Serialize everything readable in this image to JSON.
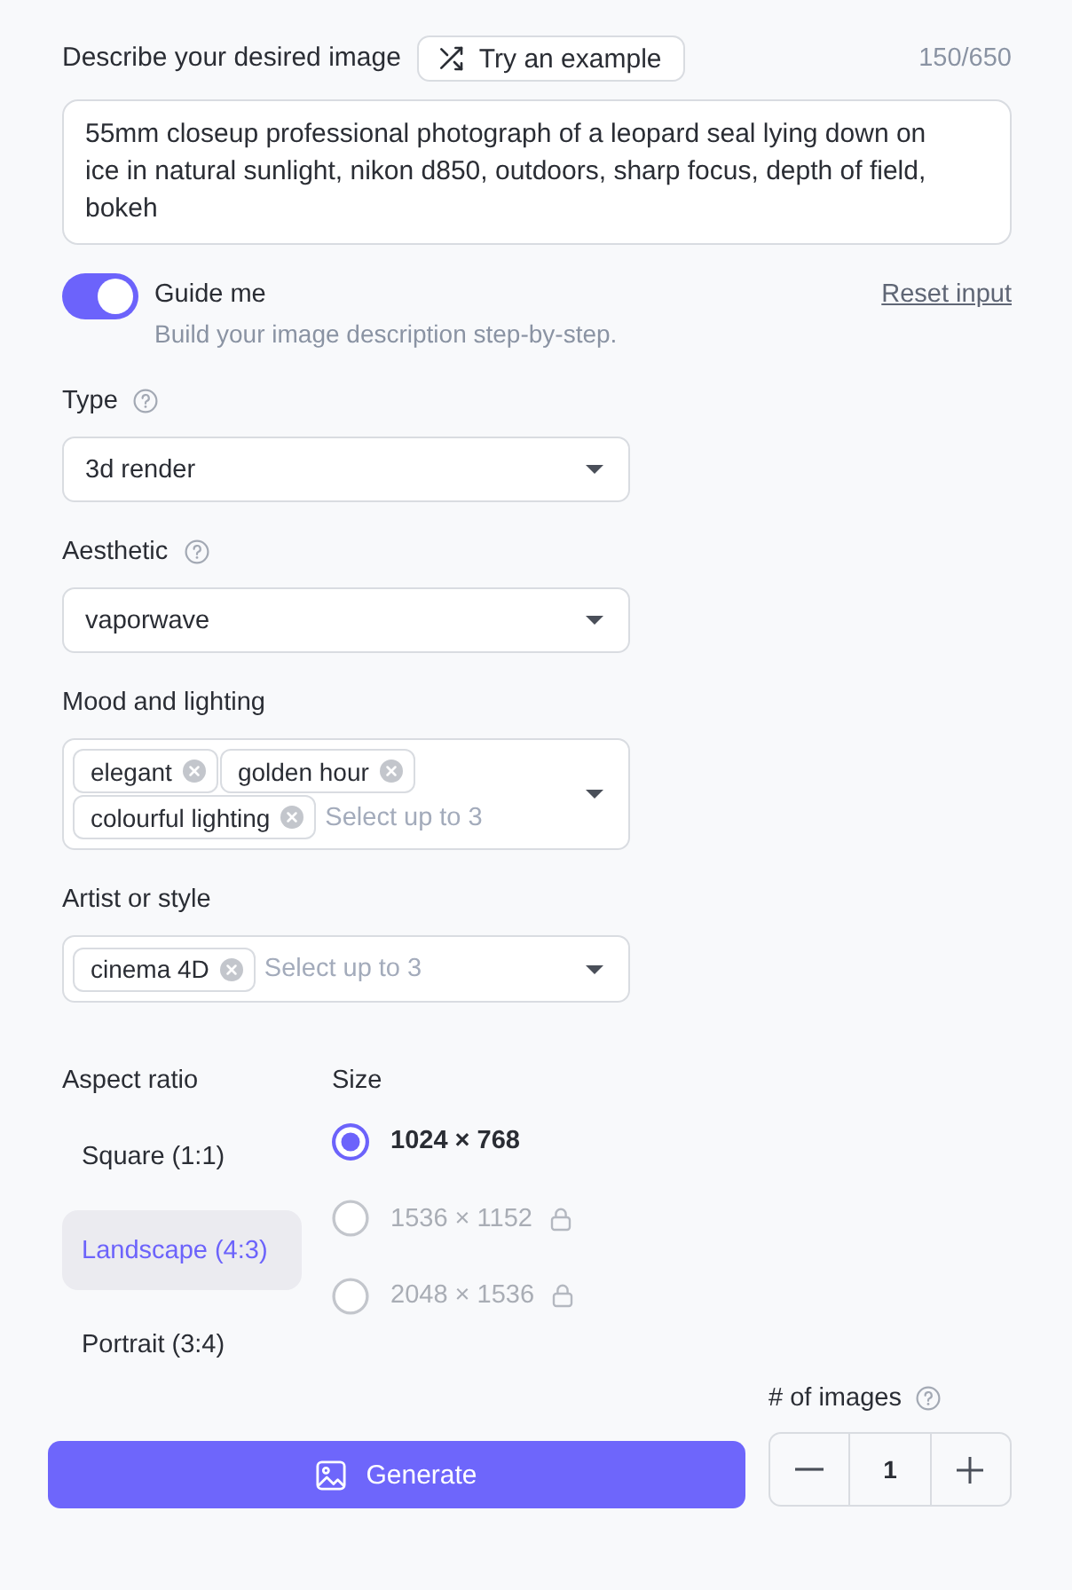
{
  "prompt": {
    "label": "Describe your desired image",
    "example_button": "Try an example",
    "counter": "150/650",
    "value": "55mm closeup professional photograph of a leopard seal lying down on ice in natural sunlight, nikon d850, outdoors, sharp focus, depth of field, bokeh"
  },
  "guide": {
    "label": "Guide me",
    "on": true,
    "hint": "Build your image description step-by-step.",
    "reset": "Reset input"
  },
  "fields": [
    {
      "kind": "select",
      "label": "Type",
      "help": true,
      "value": "3d render"
    },
    {
      "kind": "select",
      "label": "Aesthetic",
      "help": true,
      "value": "vaporwave"
    },
    {
      "kind": "multi",
      "label": "Mood and lighting",
      "help": false,
      "tags": [
        "elegant",
        "golden hour",
        "colourful lighting"
      ],
      "placeholder": "Select up to 3"
    },
    {
      "kind": "multi",
      "label": "Artist or style",
      "help": false,
      "tags": [
        "cinema 4D"
      ],
      "placeholder": "Select up to 3"
    }
  ],
  "aspect_ratio": {
    "label": "Aspect ratio",
    "options": [
      {
        "label": "Square (1:1)",
        "selected": false
      },
      {
        "label": "Landscape (4:3)",
        "selected": true
      },
      {
        "label": "Portrait (3:4)",
        "selected": false
      }
    ]
  },
  "size": {
    "label": "Size",
    "options": [
      {
        "label": "1024 × 768",
        "selected": true,
        "locked": false
      },
      {
        "label": "1536 × 1152",
        "selected": false,
        "locked": true
      },
      {
        "label": "2048 × 1536",
        "selected": false,
        "locked": true
      }
    ]
  },
  "count": {
    "label": "# of images",
    "help": true,
    "value": "1"
  },
  "generate": {
    "label": "Generate"
  }
}
